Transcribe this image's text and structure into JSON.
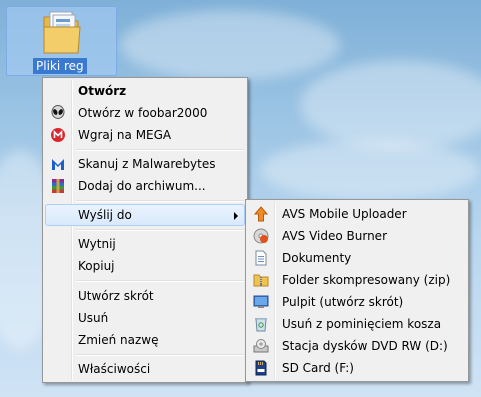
{
  "desktop_icon": {
    "label": "Pliki reg",
    "icon": "folder-icon"
  },
  "main_menu": {
    "items": [
      {
        "label": "Otwórz",
        "icon": ""
      },
      {
        "label": "Otwórz w foobar2000",
        "icon": "foobar-alien-icon"
      },
      {
        "label": "Wgraj na MEGA",
        "icon": "mega-icon"
      },
      {
        "label": "Skanuj z Malwarebytes",
        "icon": "malwarebytes-icon"
      },
      {
        "label": "Dodaj do archiwum...",
        "icon": "winrar-icon"
      },
      {
        "label": "Wyślij do",
        "icon": ""
      },
      {
        "label": "Wytnij",
        "icon": ""
      },
      {
        "label": "Kopiuj",
        "icon": ""
      },
      {
        "label": "Utwórz skrót",
        "icon": ""
      },
      {
        "label": "Usuń",
        "icon": ""
      },
      {
        "label": "Zmień nazwę",
        "icon": ""
      },
      {
        "label": "Właściwości",
        "icon": ""
      }
    ]
  },
  "send_to_menu": {
    "items": [
      {
        "label": "AVS Mobile Uploader",
        "icon": "upload-arrow-icon"
      },
      {
        "label": "AVS Video Burner",
        "icon": "disc-burner-icon"
      },
      {
        "label": "Dokumenty",
        "icon": "document-icon"
      },
      {
        "label": "Folder skompresowany (zip)",
        "icon": "zip-folder-icon"
      },
      {
        "label": "Pulpit (utwórz skrót)",
        "icon": "desktop-icon"
      },
      {
        "label": "Usuń z pominięciem kosza",
        "icon": "recycle-bin-icon"
      },
      {
        "label": "Stacja dysków DVD RW (D:)",
        "icon": "dvd-drive-icon"
      },
      {
        "label": "SD Card (F:)",
        "icon": "sd-card-icon"
      }
    ]
  },
  "colors": {
    "menu_bg": "#f0f0f0",
    "hover_bg": "#d9e9fc",
    "hover_border": "#aecff7",
    "selection_label": "#3a79d0"
  }
}
